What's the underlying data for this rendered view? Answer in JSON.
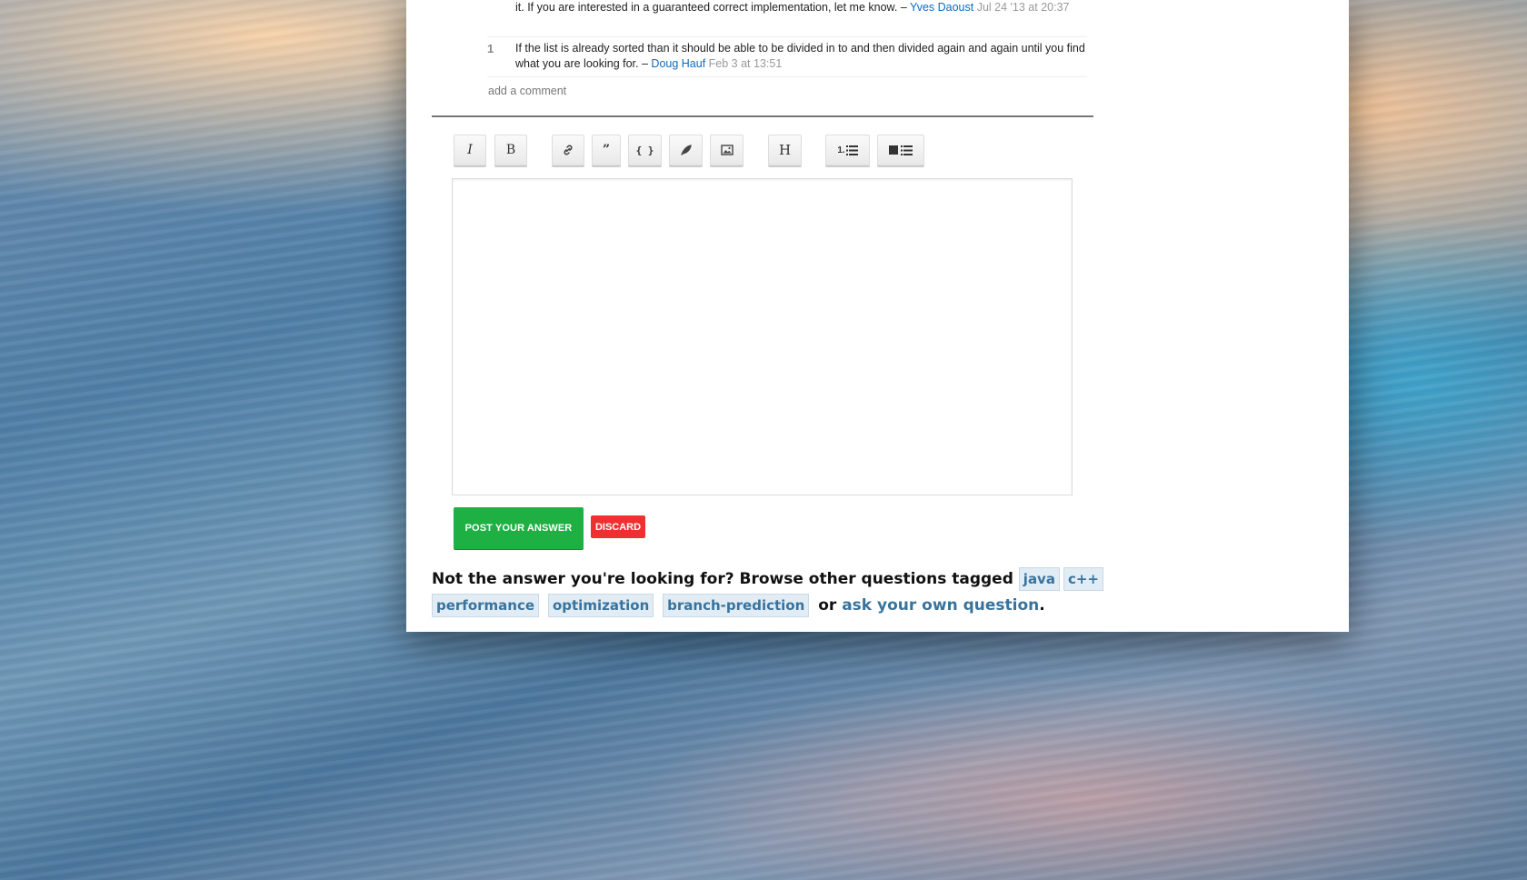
{
  "comments": [
    {
      "score": "",
      "text": "it. If you are interested in a guaranteed correct implementation, let me know. –",
      "user": "Yves Daoust",
      "date": "Jul 24 '13 at 20:37"
    },
    {
      "score": "1",
      "text": "If the list is already sorted than it should be able to be divided in to and then divided again and again until you find what you are looking for. –",
      "user": "Doug Hauf",
      "date": "Feb 3 at 13:51"
    }
  ],
  "add_comment": "add a comment",
  "toolbar": {
    "italic": "I",
    "bold": "B",
    "quote": "”",
    "code": "{ }",
    "heading": "H",
    "ordered_list": "1.",
    "icons": [
      "italic-icon",
      "bold-icon",
      "link-icon",
      "quote-icon",
      "code-icon",
      "snippet-icon",
      "image-icon",
      "heading-icon",
      "ordered-list-icon",
      "unordered-list-icon"
    ]
  },
  "buttons": {
    "post": "POST YOUR ANSWER",
    "discard": "DISCARD"
  },
  "footer": {
    "prefix": "Not the answer you're looking for? Browse other questions tagged",
    "tags": [
      "java",
      "c++",
      "performance",
      "optimization",
      "branch-prediction"
    ],
    "or": "or",
    "ask_link": "ask your own question",
    "period": "."
  },
  "colors": {
    "post_button": "#1eb042",
    "discard_button": "#f03030",
    "user_link": "#0a6bc1",
    "tag_bg": "#e1ecf4",
    "tag_text": "#39739d"
  }
}
